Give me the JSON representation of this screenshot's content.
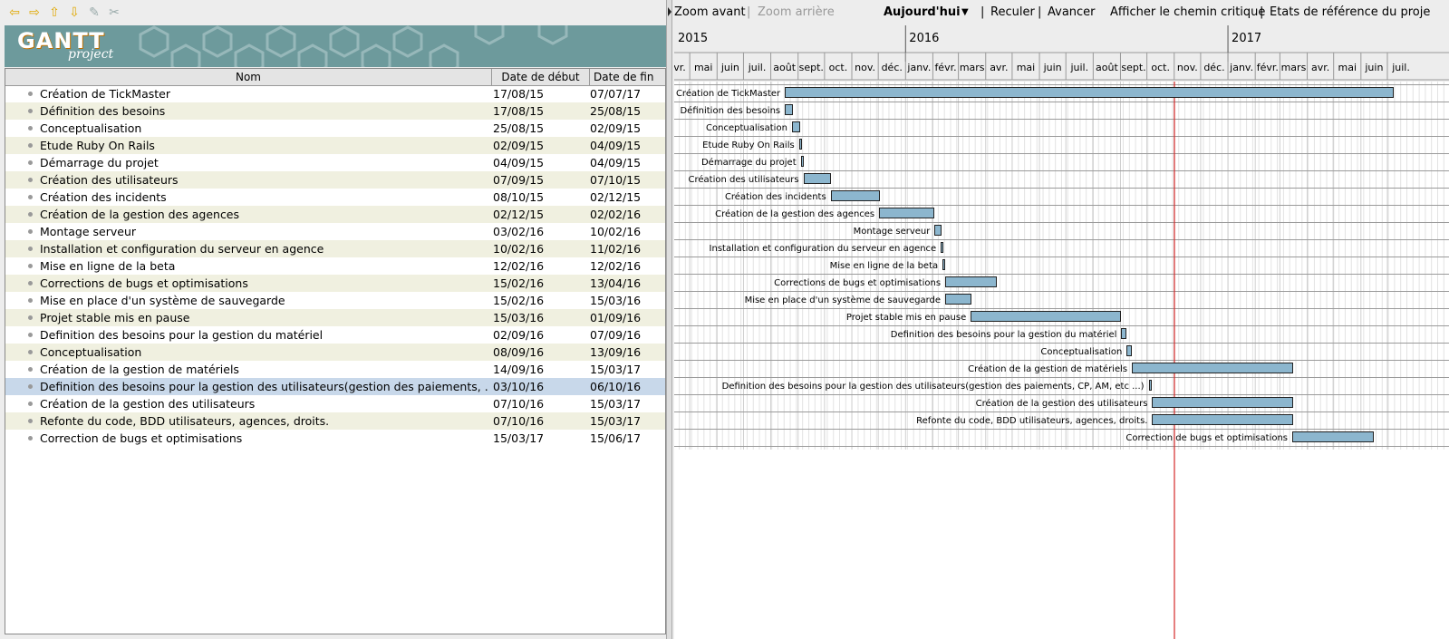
{
  "toolbar": {
    "icons": [
      "back-arrow-icon",
      "forward-arrow-icon",
      "move-up-icon",
      "move-down-icon",
      "link-icon",
      "unlink-icon"
    ]
  },
  "logo": {
    "main": "GANTT",
    "sub": "project"
  },
  "table": {
    "columns": [
      "Nom",
      "Date de début",
      "Date de fin"
    ],
    "rows": [
      {
        "name": "Création de TickMaster",
        "start": "17/08/15",
        "end": "07/07/17"
      },
      {
        "name": "Définition des besoins",
        "start": "17/08/15",
        "end": "25/08/15"
      },
      {
        "name": "Conceptualisation",
        "start": "25/08/15",
        "end": "02/09/15"
      },
      {
        "name": "Etude Ruby On Rails",
        "start": "02/09/15",
        "end": "04/09/15"
      },
      {
        "name": "Démarrage du projet",
        "start": "04/09/15",
        "end": "04/09/15"
      },
      {
        "name": "Création des utilisateurs",
        "start": "07/09/15",
        "end": "07/10/15"
      },
      {
        "name": "Création des incidents",
        "start": "08/10/15",
        "end": "02/12/15"
      },
      {
        "name": "Création de la gestion des agences",
        "start": "02/12/15",
        "end": "02/02/16"
      },
      {
        "name": "Montage serveur",
        "start": "03/02/16",
        "end": "10/02/16"
      },
      {
        "name": "Installation et configuration du serveur en agence",
        "start": "10/02/16",
        "end": "11/02/16"
      },
      {
        "name": "Mise en ligne de la beta",
        "start": "12/02/16",
        "end": "12/02/16"
      },
      {
        "name": "Corrections de bugs et optimisations",
        "start": "15/02/16",
        "end": "13/04/16"
      },
      {
        "name": "Mise en place d'un système de sauvegarde",
        "start": "15/02/16",
        "end": "15/03/16"
      },
      {
        "name": "Projet stable mis en pause",
        "start": "15/03/16",
        "end": "01/09/16"
      },
      {
        "name": "Definition des besoins pour la gestion du matériel",
        "start": "02/09/16",
        "end": "07/09/16"
      },
      {
        "name": "Conceptualisation",
        "start": "08/09/16",
        "end": "13/09/16"
      },
      {
        "name": "Création de la gestion de matériels",
        "start": "14/09/16",
        "end": "15/03/17"
      },
      {
        "name": "Definition des besoins pour la gestion des utilisateurs(gestion des paiements, ...",
        "start": "03/10/16",
        "end": "06/10/16"
      },
      {
        "name": "Création de la gestion des utilisateurs",
        "start": "07/10/16",
        "end": "15/03/17"
      },
      {
        "name": "Refonte du code, BDD utilisateurs, agences, droits.",
        "start": "07/10/16",
        "end": "15/03/17"
      },
      {
        "name": "Correction de bugs et optimisations",
        "start": "15/03/17",
        "end": "15/06/17"
      }
    ],
    "selected_index": 17
  },
  "chart_toolbar": {
    "zoom_in": "Zoom avant",
    "sep1": "|",
    "zoom_out": "Zoom arrière",
    "today": "Aujourd'hui",
    "today_arrow": "▼",
    "sep2": "|",
    "back": "Reculer",
    "sep3": "|",
    "forward": "Avancer",
    "critical_path": "Afficher le chemin critique",
    "sep4": "|",
    "baselines": "Etats de référence du proje"
  },
  "timeline": {
    "years": [
      "2015",
      "2016",
      "2017"
    ],
    "months": [
      "avr.",
      "mai",
      "juin",
      "juil.",
      "août",
      "sept.",
      "oct.",
      "nov.",
      "déc.",
      "janv.",
      "févr.",
      "mars",
      "avr.",
      "mai",
      "juin",
      "juil.",
      "août",
      "sept.",
      "oct.",
      "nov.",
      "déc.",
      "janv.",
      "févr.",
      "mars",
      "avr.",
      "mai",
      "juin",
      "juil."
    ],
    "bar_labels": [
      "Création de TickMaster",
      "Définition des besoins",
      "Conceptualisation",
      "Etude Ruby On Rails",
      "Démarrage du projet",
      "Création des utilisateurs",
      "Création des incidents",
      "Création de la gestion des agences",
      "Montage serveur",
      "Installation et configuration du serveur en agence",
      "Mise en ligne de la beta",
      "Corrections de bugs et optimisations",
      "Mise en place d'un système de sauvegarde",
      "Projet stable mis en pause",
      "Definition des besoins pour la gestion du matériel",
      "Conceptualisation",
      "Création de la gestion de matériels",
      "Definition des besoins pour la gestion des utilisateurs(gestion des paiements, CP, AM, etc ...)",
      "Création de la gestion des utilisateurs",
      "Refonte du code, BDD utilisateurs, agences, droits.",
      "Correction de bugs et optimisations"
    ],
    "today_color": "#d42a2a",
    "bar_color": "#8cb6ce"
  }
}
